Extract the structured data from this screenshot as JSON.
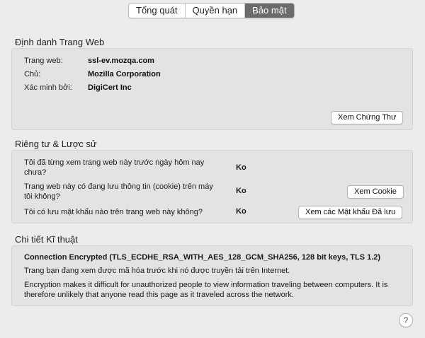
{
  "tabs": [
    {
      "label": "Tổng quát",
      "active": false
    },
    {
      "label": "Quyền hạn",
      "active": false
    },
    {
      "label": "Bảo mật",
      "active": true
    }
  ],
  "identity": {
    "title": "Định danh Trang Web",
    "rows": [
      {
        "label": "Trang web:",
        "value": "ssl-ev.mozqa.com"
      },
      {
        "label": "Chủ:",
        "value": "Mozilla Corporation"
      },
      {
        "label": "Xác minh bởi:",
        "value": "DigiCert Inc"
      }
    ],
    "view_cert_button": "Xem Chứng Thư"
  },
  "privacy": {
    "title": "Riêng tư & Lược sử",
    "rows": [
      {
        "question": "Tôi đã từng xem trang web này trước ngày hôm nay chưa?",
        "answer": "Ko"
      },
      {
        "question": "Trang web này có đang lưu thông tin (cookie) trên máy tôi không?",
        "answer": "Ko",
        "button": "Xem Cookie"
      },
      {
        "question": "Tôi có lưu mật khẩu nào trên trang web này không?",
        "answer": "Ko",
        "button": "Xem các Mật khẩu Đã lưu"
      }
    ]
  },
  "technical": {
    "title": "Chi tiết Kĩ thuật",
    "connection": "Connection Encrypted (TLS_ECDHE_RSA_WITH_AES_128_GCM_SHA256, 128 bit keys, TLS 1.2)",
    "line1": "Trang bạn đang xem được mã hóa trước khi nó được truyền tải trên Internet.",
    "line2": "Encryption makes it difficult for unauthorized people to view information traveling between computers. It is therefore unlikely that anyone read this page as it traveled across the network."
  },
  "help_label": "?"
}
